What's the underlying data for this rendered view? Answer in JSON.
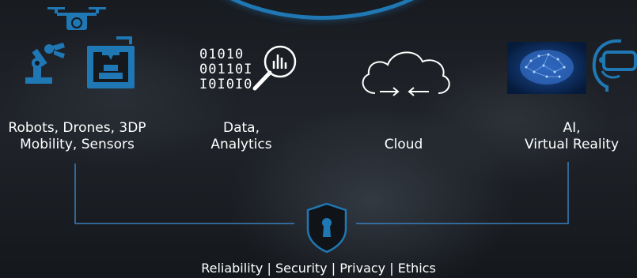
{
  "groups": [
    {
      "name": "robots",
      "line1": "Robots, Drones, 3DP",
      "line2": "Mobility, Sensors"
    },
    {
      "name": "data",
      "line1": "Data,",
      "line2": "Analytics"
    },
    {
      "name": "cloud",
      "line1": "",
      "line2": "Cloud"
    },
    {
      "name": "ai",
      "line1": "AI,",
      "line2": "Virtual Reality"
    }
  ],
  "binary": {
    "row1": "01010",
    "row2": "00110I",
    "row3": "I0I0I0"
  },
  "footer": "Reliability | Security | Privacy | Ethics",
  "colors": {
    "accent": "#1f78b4",
    "line": "#3a7fc0",
    "text": "#ffffff"
  },
  "icons": [
    "drone-icon",
    "robot-arm-icon",
    "3d-printer-icon",
    "binary-icon",
    "magnifier-chart-icon",
    "cloud-sync-icon",
    "neural-brain-icon",
    "vr-headset-icon",
    "shield-keyhole-icon"
  ]
}
